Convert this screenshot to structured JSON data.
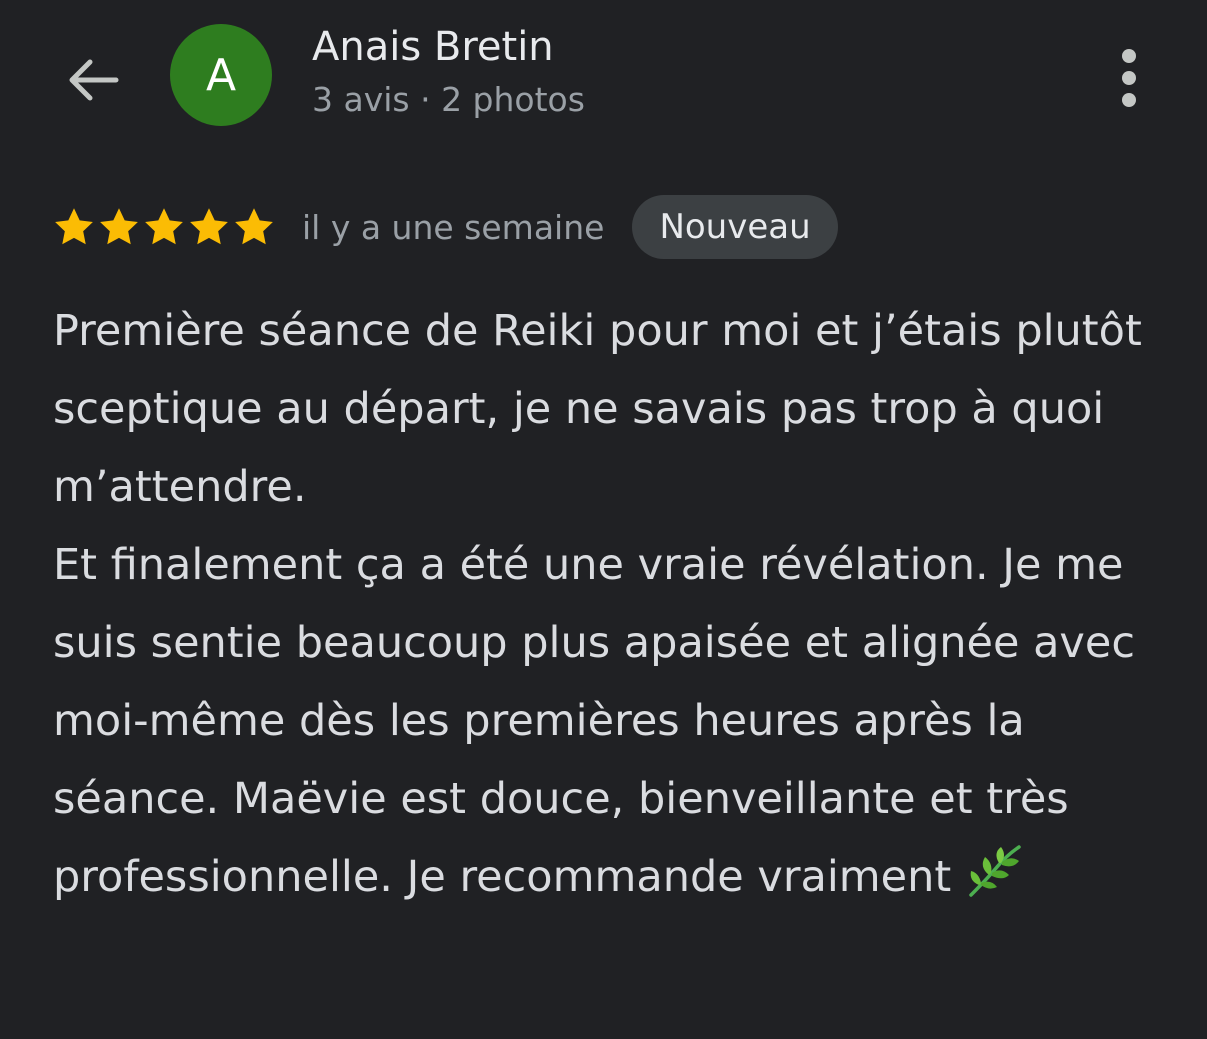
{
  "header": {
    "back_icon": "arrow-back-icon",
    "avatar_letter": "A",
    "avatar_color": "#2e7d1f",
    "user_name": "Anais Bretin",
    "user_meta": "3 avis · 2 photos",
    "more_icon": "more-vert-icon"
  },
  "review": {
    "rating": 5,
    "rating_max": 5,
    "star_color": "#fbbc04",
    "date": "il y a une semaine",
    "badge": "Nouveau",
    "text": "Première séance de Reiki pour moi et j’étais plutôt sceptique au départ, je ne savais pas trop à quoi m’attendre.\nEt finalement ça a été une vraie révélation. Je me suis sentie beaucoup plus apaisée et alignée avec moi-même dès les premières heures après la séance. Maëvie est douce, bienveillante et très professionnelle. Je recommande vraiment",
    "emoji_icon": "herb-leaf-icon"
  }
}
